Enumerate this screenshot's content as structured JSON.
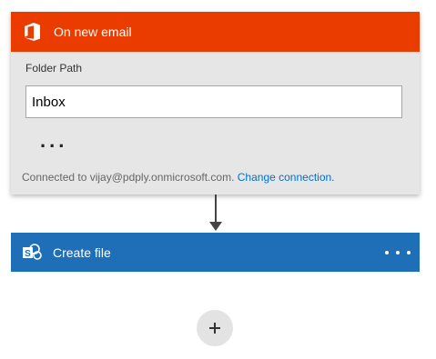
{
  "trigger": {
    "title": "On new email",
    "icon": "office-icon",
    "color": "#eb3c00",
    "field_label": "Folder Path",
    "folder_value": "Inbox",
    "more_label": "...",
    "connection_text": "Connected to vijay@pdply.onmicrosoft.com.",
    "change_connection_label": "Change connection."
  },
  "action": {
    "title": "Create file",
    "icon": "sharepoint-icon",
    "color": "#1e6fb8",
    "menu_icon": "ellipsis-icon"
  },
  "add_step": {
    "icon": "plus-icon",
    "label": "+"
  },
  "colors": {
    "trigger_body": "#e6e6e6",
    "link": "#0072c6",
    "arrow": "#444444"
  }
}
